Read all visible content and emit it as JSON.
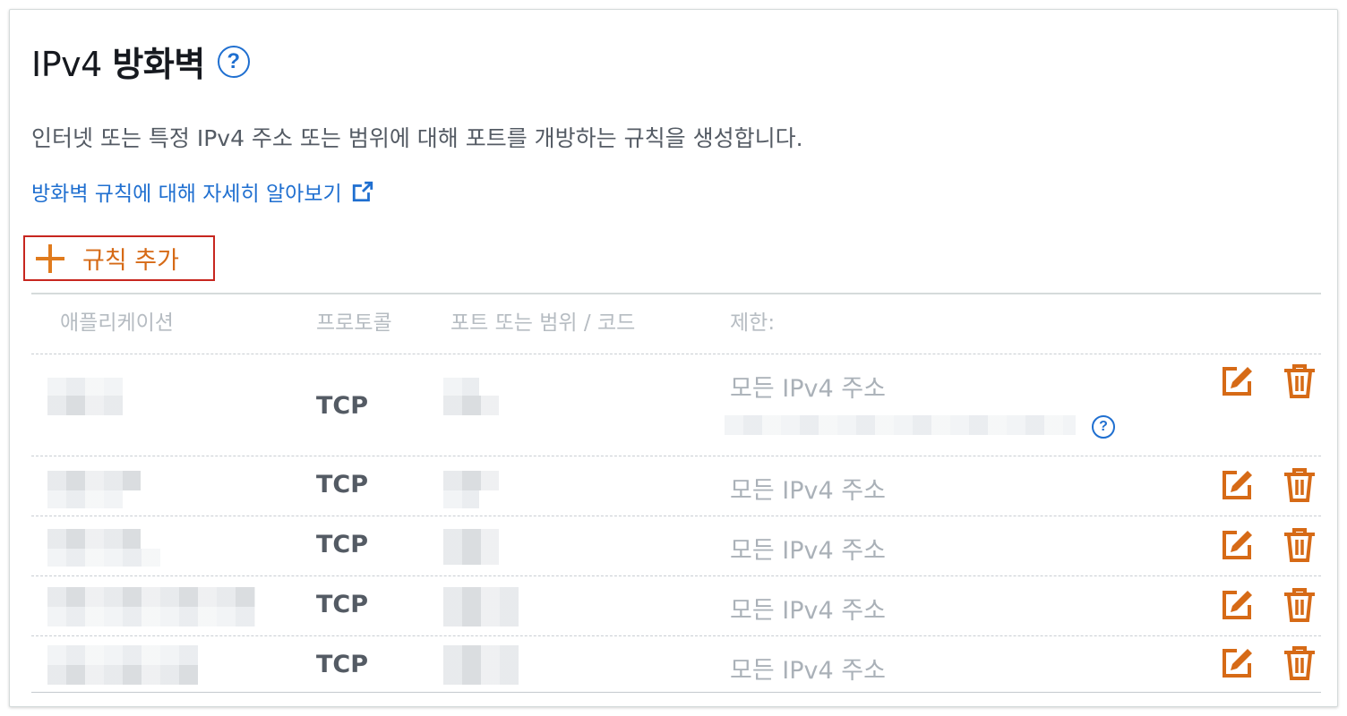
{
  "header": {
    "title_prefix": "IPv4 ",
    "title_main": "방화벽",
    "help_glyph": "?"
  },
  "description": "인터넷 또는 특정 IPv4 주소 또는 범위에 대해 포트를 개방하는 규칙을 생성합니다.",
  "learn_more_link": "방화벽 규칙에 대해 자세히 알아보기",
  "add_rule_label": "규칙 추가",
  "table": {
    "columns": [
      "애플리케이션",
      "프로토콜",
      "포트 또는 범위 / 코드",
      "제한:"
    ],
    "rows": [
      {
        "protocol": "TCP",
        "restriction": "모든 IPv4 주소"
      },
      {
        "protocol": "TCP",
        "restriction": "모든 IPv4 주소"
      },
      {
        "protocol": "TCP",
        "restriction": "모든 IPv4 주소"
      },
      {
        "protocol": "TCP",
        "restriction": "모든 IPv4 주소"
      },
      {
        "protocol": "TCP",
        "restriction": "모든 IPv4 주소"
      }
    ],
    "row_help_glyph": "?"
  },
  "colors": {
    "accent_orange": "#d66a16",
    "link_blue": "#1f6fd0",
    "highlight_red": "#c7261f"
  },
  "icons": {
    "help": "help-circle-icon",
    "external": "external-link-icon",
    "add": "plus-icon",
    "edit": "edit-icon",
    "delete": "trash-icon"
  }
}
